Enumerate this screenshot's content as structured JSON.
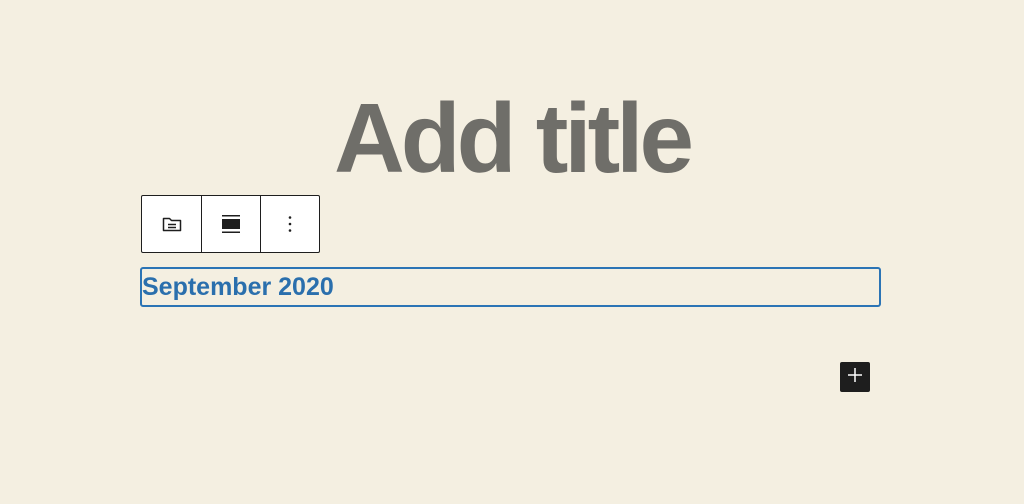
{
  "editor": {
    "title_placeholder": "Add title"
  },
  "block_toolbar": {
    "buttons": [
      {
        "icon": "archive-icon",
        "label": "Archives"
      },
      {
        "icon": "align-icon",
        "label": "Align"
      },
      {
        "icon": "more-options-icon",
        "label": "Options"
      }
    ]
  },
  "archives_block": {
    "items": [
      "September 2020"
    ]
  },
  "inserter": {
    "icon": "plus-icon"
  },
  "colors": {
    "background": "#f4efe1",
    "title": "#6f6e69",
    "link": "#2a6fad",
    "selection_border": "#2b74b5",
    "inserter_bg": "#1e1e1e"
  }
}
